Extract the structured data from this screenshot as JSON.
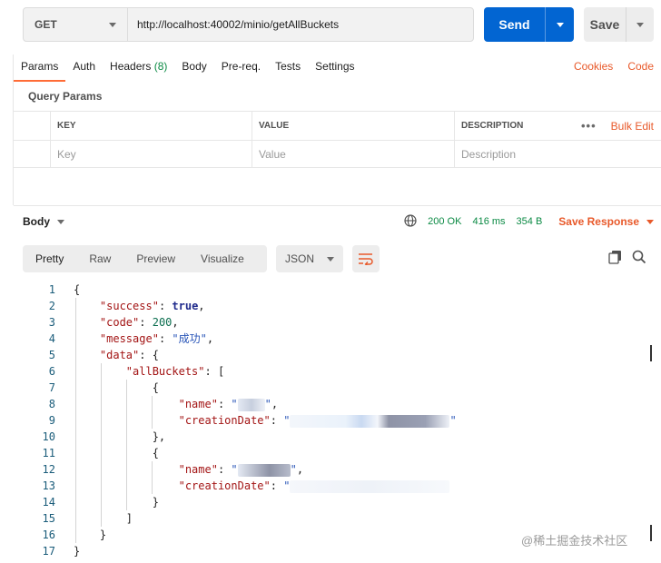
{
  "request": {
    "method": "GET",
    "url": "http://localhost:40002/minio/getAllBuckets",
    "send_label": "Send",
    "save_label": "Save"
  },
  "tabs": {
    "params": "Params",
    "auth": "Auth",
    "headers": "Headers",
    "headers_count": "(8)",
    "body": "Body",
    "prereq": "Pre-req.",
    "tests": "Tests",
    "settings": "Settings",
    "cookies": "Cookies",
    "code": "Code"
  },
  "query_params": {
    "title": "Query Params",
    "headers": [
      "KEY",
      "VALUE",
      "DESCRIPTION"
    ],
    "placeholders": [
      "Key",
      "Value",
      "Description"
    ],
    "more": "•••",
    "bulk_edit": "Bulk Edit"
  },
  "response": {
    "body_label": "Body",
    "status": "200 OK",
    "time": "416 ms",
    "size": "354 B",
    "save_response": "Save Response",
    "views": [
      "Pretty",
      "Raw",
      "Preview",
      "Visualize"
    ],
    "active_view": "Pretty",
    "format": "JSON"
  },
  "code_lines": {
    "numbers": [
      "1",
      "2",
      "3",
      "4",
      "5",
      "6",
      "7",
      "8",
      "9",
      "10",
      "11",
      "12",
      "13",
      "14",
      "15",
      "16",
      "17"
    ],
    "success_key": "\"success\"",
    "success_val": "true",
    "code_key": "\"code\"",
    "code_val": "200",
    "message_key": "\"message\"",
    "message_val": "\"成功\"",
    "data_key": "\"data\"",
    "buckets_key": "\"allBuckets\"",
    "name_key": "\"name\"",
    "creation_key": "\"creationDate\""
  },
  "watermark": "@稀土掘金技术社区",
  "colors": {
    "accent": "#ff6c37",
    "send_blue": "#0265d2",
    "status_green": "#0b8a44",
    "link_orange": "#e8592a"
  }
}
